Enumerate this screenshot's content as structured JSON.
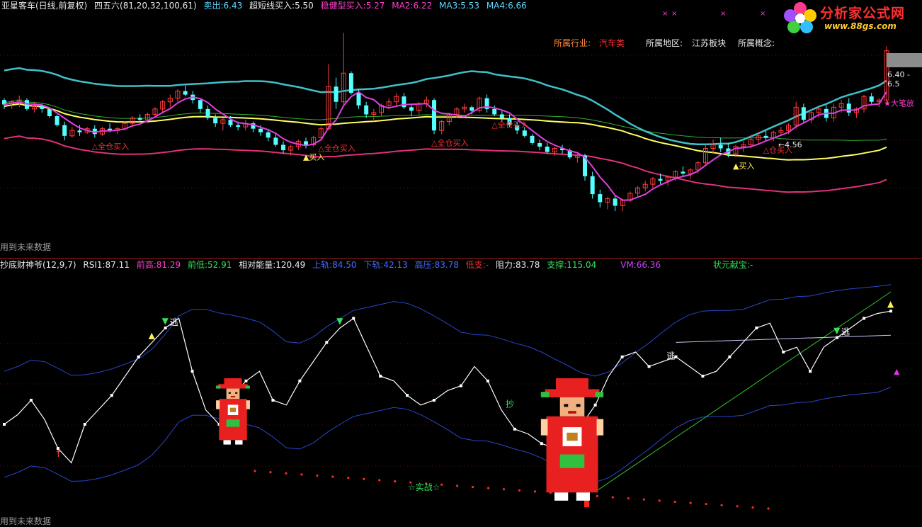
{
  "top_header": {
    "stock": "亚星客车(日线,前复权)",
    "indicator": "四五六(81,20,32,100,61)",
    "sell_label": "卖出:",
    "sell_value": "6.43",
    "ultra_short_label": "超短线买入:",
    "ultra_short_value": "5.50",
    "steady_label": "稳健型买入:",
    "steady_value": "5.27",
    "ma2_label": "MA2:",
    "ma2_value": "6.22",
    "ma3_label": "MA3:",
    "ma3_value": "5.53",
    "ma4_label": "MA4:",
    "ma4_value": "6.66"
  },
  "info_bar": {
    "industry_label": "所属行业:",
    "industry_value": "汽车类",
    "region_label": "所属地区:",
    "region_value": "江苏板块",
    "concept_label": "所属概念:"
  },
  "logo": {
    "title": "分析家公式网",
    "url": "www.88gs.com"
  },
  "price_marker": {
    "label": "6.40 - 6.5"
  },
  "top_footer": "用到未来数据",
  "bottom_footer": "用到未来数据",
  "bottom_header": {
    "indicator": "抄底财神爷(12,9,7)",
    "rsi_label": "RSI1:",
    "rsi_value": "87.11",
    "prev_high_label": "前高:",
    "prev_high_value": "81.29",
    "prev_low_label": "前低:",
    "prev_low_value": "52.91",
    "rel_energy_label": "相对能量:",
    "rel_energy_value": "120.49",
    "upper_label": "上轨:",
    "upper_value": "84.50",
    "lower_label": "下轨:",
    "lower_value": "42.13",
    "high_press_label": "高压:",
    "high_press_value": "83.78",
    "low_support_label": "低支:",
    "low_support_value": "-",
    "resist_label": "阻力:",
    "resist_value": "83.78",
    "support_label": "支撑:",
    "support_value": "115.04",
    "vm_label": "VM:",
    "vm_value": "66.36",
    "top_scholar_label": "状元献宝:",
    "top_scholar_value": "-"
  },
  "colors": {
    "up_candle": "#ff3c3c",
    "down_candle": "#54ffff",
    "ma2": "#e040e0",
    "ma3": "#ffff60",
    "ma4": "#40c0c8",
    "ma_long": "#30b030",
    "lower_band": "#e0307a",
    "rsi": "#ffffff",
    "bands": "#2a46c8",
    "trend": "#30c030",
    "dots": "#ff2a2a"
  },
  "chart_data": [
    {
      "type": "candlestick",
      "title": "亚星客车(日线,前复权)",
      "annotations": [
        {
          "text": "△全仓买入",
          "series_index": 12
        },
        {
          "text": "▲买入",
          "series_index": 40
        },
        {
          "text": "△全仓买入",
          "series_index": 42
        },
        {
          "text": "△全仓买入",
          "series_index": 57
        },
        {
          "text": "△全仓买入",
          "series_index": 65
        },
        {
          "text": "▲买入",
          "series_index": 97
        },
        {
          "text": "△仓买入",
          "series_index": 101
        },
        {
          "text": "←4.56",
          "series_index": 103
        },
        {
          "text": "★大笔放",
          "series_index": 150
        }
      ],
      "candles": [
        [
          5.8,
          5.82,
          5.7,
          5.75
        ],
        [
          5.76,
          5.8,
          5.7,
          5.78
        ],
        [
          5.78,
          5.85,
          5.72,
          5.8
        ],
        [
          5.8,
          5.82,
          5.68,
          5.7
        ],
        [
          5.7,
          5.78,
          5.66,
          5.74
        ],
        [
          5.74,
          5.76,
          5.66,
          5.7
        ],
        [
          5.7,
          5.72,
          5.6,
          5.62
        ],
        [
          5.62,
          5.64,
          5.5,
          5.52
        ],
        [
          5.52,
          5.56,
          5.35,
          5.4
        ],
        [
          5.4,
          5.5,
          5.38,
          5.46
        ],
        [
          5.46,
          5.52,
          5.4,
          5.44
        ],
        [
          5.44,
          5.5,
          5.42,
          5.48
        ],
        [
          5.48,
          5.52,
          5.38,
          5.42
        ],
        [
          5.42,
          5.5,
          5.4,
          5.48
        ],
        [
          5.48,
          5.54,
          5.44,
          5.46
        ],
        [
          5.46,
          5.5,
          5.42,
          5.48
        ],
        [
          5.48,
          5.56,
          5.46,
          5.54
        ],
        [
          5.54,
          5.62,
          5.5,
          5.6
        ],
        [
          5.6,
          5.64,
          5.56,
          5.58
        ],
        [
          5.58,
          5.66,
          5.54,
          5.64
        ],
        [
          5.64,
          5.72,
          5.6,
          5.7
        ],
        [
          5.7,
          5.8,
          5.66,
          5.78
        ],
        [
          5.78,
          5.86,
          5.72,
          5.82
        ],
        [
          5.82,
          5.92,
          5.78,
          5.9
        ],
        [
          5.9,
          5.96,
          5.84,
          5.86
        ],
        [
          5.86,
          5.9,
          5.76,
          5.8
        ],
        [
          5.8,
          5.82,
          5.66,
          5.7
        ],
        [
          5.7,
          5.74,
          5.58,
          5.6
        ],
        [
          5.6,
          5.64,
          5.5,
          5.54
        ],
        [
          5.54,
          5.6,
          5.46,
          5.58
        ],
        [
          5.58,
          5.62,
          5.5,
          5.52
        ],
        [
          5.52,
          5.56,
          5.46,
          5.5
        ],
        [
          5.5,
          5.58,
          5.46,
          5.54
        ],
        [
          5.54,
          5.56,
          5.44,
          5.48
        ],
        [
          5.48,
          5.52,
          5.4,
          5.44
        ],
        [
          5.44,
          5.48,
          5.34,
          5.38
        ],
        [
          5.38,
          5.42,
          5.28,
          5.3
        ],
        [
          5.3,
          5.34,
          5.2,
          5.24
        ],
        [
          5.24,
          5.3,
          5.18,
          5.28
        ],
        [
          5.28,
          5.36,
          5.24,
          5.34
        ],
        [
          5.34,
          5.38,
          5.26,
          5.3
        ],
        [
          5.3,
          5.4,
          5.28,
          5.38
        ],
        [
          5.38,
          5.5,
          5.36,
          5.48
        ],
        [
          5.48,
          6.2,
          5.46,
          5.95
        ],
        [
          5.95,
          6.05,
          5.7,
          5.78
        ],
        [
          5.78,
          6.55,
          5.74,
          6.1
        ],
        [
          6.1,
          6.12,
          5.86,
          5.88
        ],
        [
          5.88,
          5.92,
          5.7,
          5.74
        ],
        [
          5.74,
          5.78,
          5.6,
          5.64
        ],
        [
          5.64,
          5.7,
          5.56,
          5.66
        ],
        [
          5.66,
          5.76,
          5.62,
          5.74
        ],
        [
          5.74,
          5.82,
          5.7,
          5.78
        ],
        [
          5.78,
          5.88,
          5.74,
          5.84
        ],
        [
          5.84,
          5.88,
          5.7,
          5.72
        ],
        [
          5.72,
          5.76,
          5.62,
          5.68
        ],
        [
          5.68,
          5.78,
          5.64,
          5.76
        ],
        [
          5.76,
          5.84,
          5.72,
          5.8
        ],
        [
          5.8,
          5.82,
          5.42,
          5.46
        ],
        [
          5.46,
          5.58,
          5.42,
          5.56
        ],
        [
          5.56,
          5.66,
          5.52,
          5.64
        ],
        [
          5.64,
          5.72,
          5.6,
          5.7
        ],
        [
          5.7,
          5.76,
          5.66,
          5.72
        ],
        [
          5.72,
          5.74,
          5.64,
          5.68
        ],
        [
          5.68,
          5.84,
          5.66,
          5.82
        ],
        [
          5.82,
          5.86,
          5.66,
          5.7
        ],
        [
          5.7,
          5.74,
          5.62,
          5.64
        ],
        [
          5.64,
          5.68,
          5.56,
          5.6
        ],
        [
          5.6,
          5.64,
          5.5,
          5.52
        ],
        [
          5.52,
          5.56,
          5.42,
          5.46
        ],
        [
          5.46,
          5.5,
          5.38,
          5.4
        ],
        [
          5.4,
          5.42,
          5.3,
          5.32
        ],
        [
          5.32,
          5.36,
          5.24,
          5.28
        ],
        [
          5.28,
          5.32,
          5.2,
          5.22
        ],
        [
          5.22,
          5.28,
          5.18,
          5.26
        ],
        [
          5.26,
          5.3,
          5.2,
          5.24
        ],
        [
          5.24,
          5.26,
          5.14,
          5.16
        ],
        [
          5.16,
          5.2,
          5.1,
          5.18
        ],
        [
          5.18,
          5.2,
          4.9,
          4.95
        ],
        [
          4.95,
          5.0,
          4.7,
          4.75
        ],
        [
          4.75,
          4.8,
          4.6,
          4.66
        ],
        [
          4.66,
          4.72,
          4.58,
          4.7
        ],
        [
          4.7,
          4.74,
          4.56,
          4.62
        ],
        [
          4.62,
          4.7,
          4.56,
          4.68
        ],
        [
          4.68,
          4.78,
          4.66,
          4.76
        ],
        [
          4.76,
          4.84,
          4.72,
          4.82
        ],
        [
          4.82,
          4.9,
          4.78,
          4.86
        ],
        [
          4.86,
          4.94,
          4.82,
          4.92
        ],
        [
          4.92,
          4.98,
          4.86,
          4.9
        ],
        [
          4.9,
          4.96,
          4.84,
          4.94
        ],
        [
          4.94,
          5.02,
          4.9,
          5.0
        ],
        [
          5.0,
          5.06,
          4.94,
          4.98
        ],
        [
          4.98,
          5.04,
          4.92,
          5.02
        ],
        [
          5.02,
          5.12,
          4.98,
          5.1
        ],
        [
          5.1,
          5.3,
          5.06,
          5.26
        ],
        [
          5.26,
          5.36,
          5.2,
          5.3
        ],
        [
          5.3,
          5.38,
          5.22,
          5.26
        ],
        [
          5.26,
          5.32,
          5.16,
          5.2
        ],
        [
          5.2,
          5.3,
          5.16,
          5.28
        ],
        [
          5.28,
          5.34,
          5.22,
          5.3
        ],
        [
          5.3,
          5.4,
          5.26,
          5.36
        ],
        [
          5.36,
          5.44,
          5.3,
          5.4
        ],
        [
          5.4,
          5.46,
          5.34,
          5.38
        ],
        [
          5.38,
          5.46,
          5.34,
          5.44
        ],
        [
          5.44,
          5.5,
          5.4,
          5.46
        ],
        [
          5.46,
          5.54,
          5.42,
          5.52
        ],
        [
          5.52,
          5.78,
          5.48,
          5.72
        ],
        [
          5.72,
          5.76,
          5.54,
          5.58
        ],
        [
          5.58,
          5.7,
          5.54,
          5.66
        ],
        [
          5.66,
          5.72,
          5.6,
          5.7
        ],
        [
          5.7,
          5.74,
          5.56,
          5.6
        ],
        [
          5.6,
          5.76,
          5.56,
          5.72
        ],
        [
          5.72,
          5.8,
          5.66,
          5.76
        ],
        [
          5.76,
          5.82,
          5.62,
          5.66
        ],
        [
          5.66,
          5.72,
          5.6,
          5.7
        ],
        [
          5.7,
          5.86,
          5.66,
          5.84
        ],
        [
          5.84,
          5.88,
          5.74,
          5.78
        ],
        [
          5.78,
          5.82,
          5.72,
          5.8
        ],
        [
          5.8,
          6.4,
          5.78,
          6.35
        ]
      ]
    },
    {
      "type": "line",
      "title": "抄底财神爷(12,9,7)",
      "rsi": [
        40,
        44,
        50,
        42,
        30,
        24,
        40,
        46,
        52,
        60,
        68,
        74,
        80,
        84,
        62,
        46,
        40,
        52,
        58,
        62,
        50,
        48,
        58,
        66,
        74,
        80,
        84,
        72,
        60,
        58,
        52,
        48,
        50,
        54,
        56,
        64,
        58,
        46,
        38,
        36,
        32,
        30,
        34,
        40,
        48,
        60,
        68,
        70,
        64,
        66,
        68,
        64,
        60,
        62,
        68,
        74,
        80,
        82,
        70,
        72,
        62,
        72,
        76,
        80,
        84,
        86,
        87
      ],
      "annotations": [
        {
          "text": "逃",
          "series_index": 12
        },
        {
          "text": "抄",
          "series_index": 37
        },
        {
          "text": "逃",
          "series_index": 49
        },
        {
          "text": "逃",
          "series_index": 62
        },
        {
          "text": "☆实战☆",
          "series_index": 33
        }
      ]
    }
  ]
}
